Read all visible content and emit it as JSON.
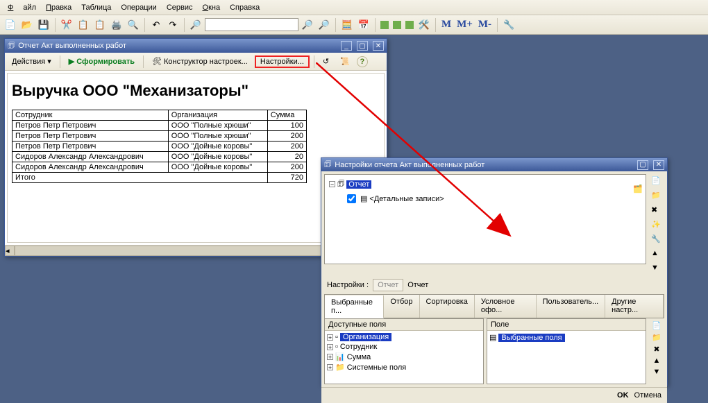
{
  "menu": {
    "file": "Файл",
    "edit": "Правка",
    "table": "Таблица",
    "ops": "Операции",
    "service": "Сервис",
    "windows": "Окна",
    "help": "Справка"
  },
  "report_window": {
    "title": "Отчет  Акт выполненных работ",
    "actions_label": "Действия",
    "form": "Сформировать",
    "constructor": "Конструктор настроек...",
    "settings": "Настройки...",
    "heading": "Выручка ООО \"Механизаторы\"",
    "cols": {
      "employee": "Сотрудник",
      "org": "Организация",
      "sum": "Сумма"
    },
    "rows": [
      {
        "employee": "Петров Петр Петрович",
        "org": "ООО \"Полные хрюши\"",
        "sum": "100"
      },
      {
        "employee": "Петров Петр Петрович",
        "org": "ООО \"Полные хрюши\"",
        "sum": "200"
      },
      {
        "employee": "Петров Петр Петрович",
        "org": "ООО \"Дойные коровы\"",
        "sum": "200"
      },
      {
        "employee": "Сидоров Александр Александрович",
        "org": "ООО \"Дойные коровы\"",
        "sum": "20"
      },
      {
        "employee": "Сидоров Александр Александрович",
        "org": "ООО \"Дойные коровы\"",
        "sum": "200"
      }
    ],
    "total_label": "Итого",
    "total_value": "720"
  },
  "settings_window": {
    "title": "Настройки отчета  Акт выполненных работ",
    "tree_root": "Отчет",
    "tree_child": "<Детальные записи>",
    "config_label": "Настройки :",
    "config_chip1": "Отчет",
    "config_chip2": "Отчет",
    "tabs": [
      "Выбранные п...",
      "Отбор",
      "Сортировка",
      "Условное офо...",
      "Пользователь...",
      "Другие настр..."
    ],
    "avail_header": "Доступные поля",
    "avail_fields": [
      "Организация",
      "Сотрудник",
      "Сумма",
      "Системные поля"
    ],
    "field_header": "Поле",
    "field_selected": "Выбранные поля",
    "ok": "OK",
    "cancel": "Отмена"
  },
  "toolbar": {
    "M": "M",
    "Mplus": "M+",
    "Mminus": "M-"
  }
}
